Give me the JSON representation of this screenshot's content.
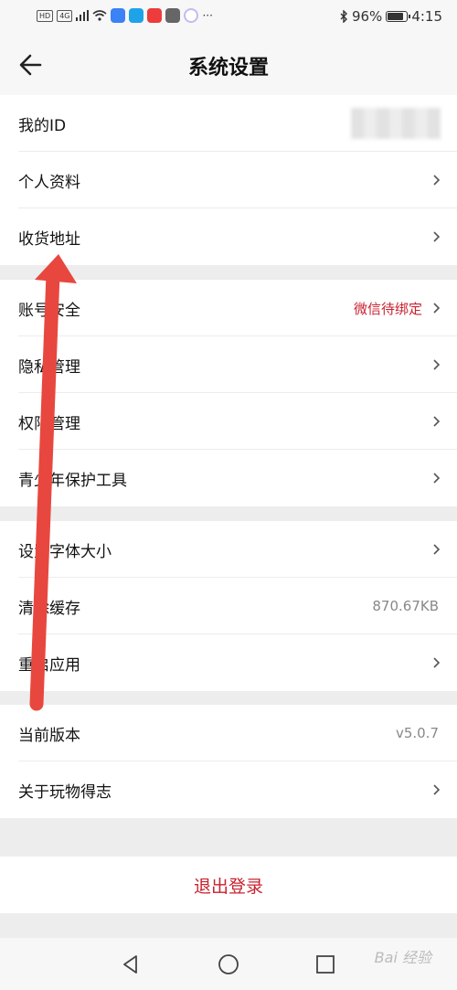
{
  "status_bar": {
    "network_tag": "HD",
    "signal_tag": "4G",
    "battery": "96%",
    "time": "4:15"
  },
  "header": {
    "title": "系统设置"
  },
  "groups": [
    [
      {
        "label": "我的ID",
        "value": "",
        "masked": true,
        "chevron": false
      },
      {
        "label": "个人资料",
        "value": "",
        "chevron": true
      },
      {
        "label": "收货地址",
        "value": "",
        "chevron": true
      }
    ],
    [
      {
        "label": "账号安全",
        "value": "微信待绑定",
        "value_color": "#c8222f",
        "chevron": true
      },
      {
        "label": "隐私管理",
        "value": "",
        "chevron": true
      },
      {
        "label": "权限管理",
        "value": "",
        "chevron": true
      },
      {
        "label": "青少年保护工具",
        "value": "",
        "chevron": true
      }
    ],
    [
      {
        "label": "设置字体大小",
        "value": "",
        "chevron": true
      },
      {
        "label": "清除缓存",
        "value": "870.67KB",
        "chevron": false
      },
      {
        "label": "重启应用",
        "value": "",
        "chevron": true
      }
    ],
    [
      {
        "label": "当前版本",
        "value": "v5.0.7",
        "chevron": false
      },
      {
        "label": "关于玩物得志",
        "value": "",
        "chevron": true
      }
    ]
  ],
  "logout_label": "退出登录",
  "watermark": "Bai 经验",
  "colors": {
    "accent_red": "#c8222f",
    "annotation_arrow": "#e8473f",
    "background": "#ededed"
  }
}
